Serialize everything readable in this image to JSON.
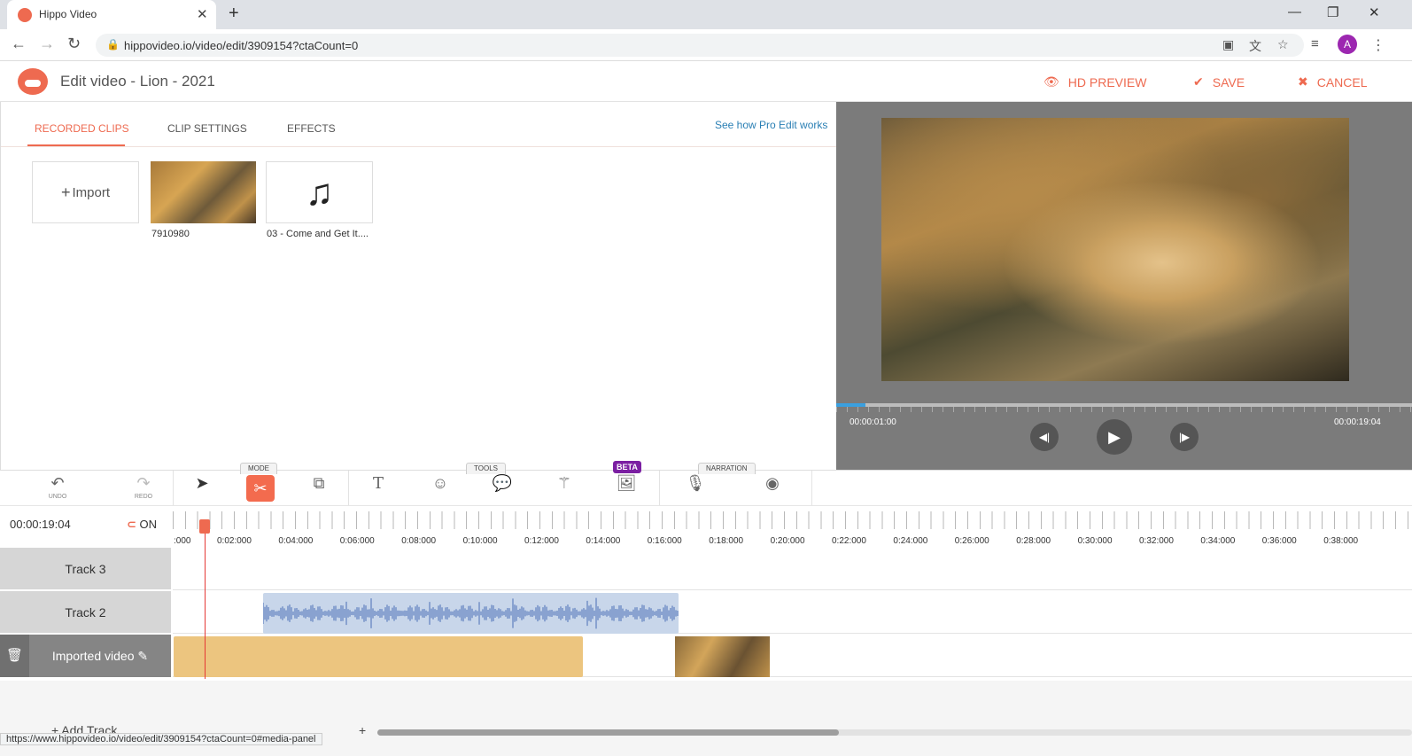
{
  "browser": {
    "tab_title": "Hippo Video",
    "url": "hippovideo.io/video/edit/3909154?ctaCount=0",
    "status_url": "https://www.hippovideo.io/video/edit/3909154?ctaCount=0#media-panel",
    "profile_initial": "A"
  },
  "header": {
    "title": "Edit video - Lion - 2021",
    "hd_preview": "HD PREVIEW",
    "save": "SAVE",
    "cancel": "CANCEL"
  },
  "panel": {
    "tabs": [
      "RECORDED CLIPS",
      "CLIP SETTINGS",
      "EFFECTS"
    ],
    "active_tab": "RECORDED CLIPS",
    "pro_link": "See how Pro Edit works",
    "import_label": "Import",
    "clips": [
      {
        "name": "7910980",
        "type": "video"
      },
      {
        "name": "03 - Come and Get It....",
        "type": "audio"
      }
    ]
  },
  "preview": {
    "current_time": "00:00:01:00",
    "total_time": "00:00:19:04",
    "progress": 0.05
  },
  "toolbar": {
    "undo": "UNDO",
    "redo": "REDO",
    "mode_group": "MODE",
    "tools_group": "TOOLS",
    "narration_group": "NARRATION",
    "beta": "BETA"
  },
  "timeline": {
    "current_time": "00:00:19:04",
    "snap": "ON",
    "ticks": [
      ":000",
      "0:02:000",
      "0:04:000",
      "0:06:000",
      "0:08:000",
      "0:10:000",
      "0:12:000",
      "0:14:000",
      "0:16:000",
      "0:18:000",
      "0:20:000",
      "0:22:000",
      "0:24:000",
      "0:26:000",
      "0:28:000",
      "0:30:000",
      "0:32:000",
      "0:34:000",
      "0:36:000",
      "0:38:000"
    ],
    "tracks": [
      "Track 3",
      "Track 2",
      "Imported video"
    ],
    "add_track": "+ Add Track"
  },
  "colors": {
    "accent": "#ee6a50",
    "audio_clip": "#c8d6ea",
    "video_clip": "#ecc57f",
    "beta": "#7b1fa2"
  }
}
